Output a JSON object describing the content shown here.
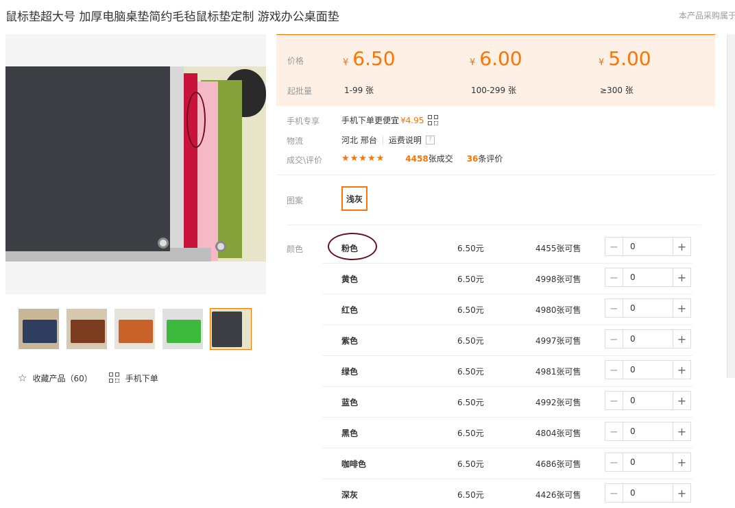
{
  "product": {
    "title": "鼠标垫超大号 加厚电脑桌垫简约毛毡鼠标垫定制 游戏办公桌面垫",
    "notice": "本产品采购属于"
  },
  "price_box": {
    "price_label": "价格",
    "moq_label": "起批量",
    "currency": "¥",
    "tiers": [
      {
        "price": "6.50",
        "range": "1-99 张"
      },
      {
        "price": "6.00",
        "range": "100-299 张"
      },
      {
        "price": "5.00",
        "range": "≥300 张"
      }
    ]
  },
  "info": {
    "mobile_label": "手机专享",
    "mobile_text": "手机下单更便宜",
    "mobile_price": "¥4.95",
    "logistics_label": "物流",
    "logistics_location": "河北 邢台",
    "shipping_link": "运费说明",
    "help_glyph": "?",
    "deal_label": "成交\\评价",
    "stars": "★★★★★",
    "deals_count": "4458",
    "deals_suffix": "张成交",
    "reviews_count": "36",
    "reviews_suffix": "条评价"
  },
  "pattern": {
    "label": "图案",
    "selected": "浅灰"
  },
  "color_label": "颜色",
  "skus": [
    {
      "name": "粉色",
      "price": "6.50元",
      "stock": "4455张可售",
      "qty": "0"
    },
    {
      "name": "黄色",
      "price": "6.50元",
      "stock": "4998张可售",
      "qty": "0"
    },
    {
      "name": "红色",
      "price": "6.50元",
      "stock": "4980张可售",
      "qty": "0"
    },
    {
      "name": "紫色",
      "price": "6.50元",
      "stock": "4997张可售",
      "qty": "0"
    },
    {
      "name": "绿色",
      "price": "6.50元",
      "stock": "4981张可售",
      "qty": "0"
    },
    {
      "name": "蓝色",
      "price": "6.50元",
      "stock": "4992张可售",
      "qty": "0"
    },
    {
      "name": "黑色",
      "price": "6.50元",
      "stock": "4804张可售",
      "qty": "0"
    },
    {
      "name": "咖啡色",
      "price": "6.50元",
      "stock": "4686张可售",
      "qty": "0"
    },
    {
      "name": "深灰",
      "price": "6.50元",
      "stock": "4426张可售",
      "qty": "0"
    }
  ],
  "stepper": {
    "minus": "−",
    "plus": "+"
  },
  "actions": {
    "favorite_icon": "☆",
    "favorite": "收藏产品（60）",
    "mobile_order": "手机下单"
  },
  "colors": {
    "accent": "#ff7300",
    "price_bg": "#fef0e4",
    "annotation": "#6b0f1a"
  }
}
